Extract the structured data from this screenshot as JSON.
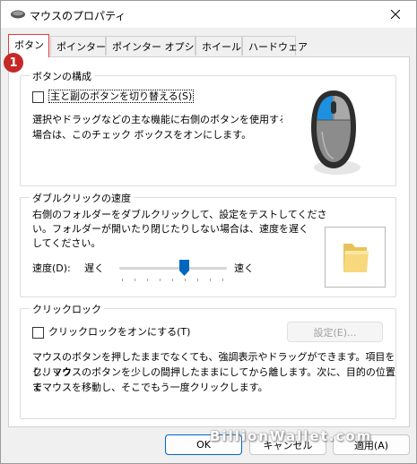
{
  "window": {
    "title": "マウスのプロパティ"
  },
  "tabs": [
    {
      "label": "ボタン"
    },
    {
      "label": "ポインター"
    },
    {
      "label": "ポインター オプション"
    },
    {
      "label": "ホイール"
    },
    {
      "label": "ハードウェア"
    }
  ],
  "step_badge": "1",
  "button_config": {
    "legend": "ボタンの構成",
    "checkbox_label": "主と副のボタンを切り替える(S)",
    "checked": false,
    "description_line1": "選択やドラッグなどの主な機能に右側のボタンを使用する",
    "description_line2": "場合は、このチェック ボックスをオンにします。",
    "mouse_icon": "mouse-left-button-highlight-icon",
    "accent_color": "#1e90e0"
  },
  "double_click": {
    "legend": "ダブルクリックの速度",
    "description_line1": "右側のフォルダーをダブルクリックして、設定をテストしてくださ",
    "description_line2": "い。フォルダーが開いたり閉じたりしない場合は、速度を遅く",
    "description_line3": "してください。",
    "speed_label": "速度(D):",
    "slow_label": "遅く",
    "fast_label": "速く",
    "speed_value": 0.6,
    "folder_icon": "folder-icon"
  },
  "click_lock": {
    "legend": "クリックロック",
    "checkbox_label": "クリックロックをオンにする(T)",
    "checked": false,
    "settings_label": "設定(E)...",
    "description_line1": "マウスのボタンを押したままでなくても、強調表示やドラッグができます。項目をクリック",
    "description_line2": "し、マウスのボタンを少しの間押したままにしてから離します。次に、目的の位置ま",
    "description_line3": "でマウスを移動し、そこでもう一度クリックします。"
  },
  "footer": {
    "ok_label": "OK",
    "cancel_label": "キャンセル",
    "apply_label": "適用(A)"
  },
  "watermark": "BillionWallet.com"
}
